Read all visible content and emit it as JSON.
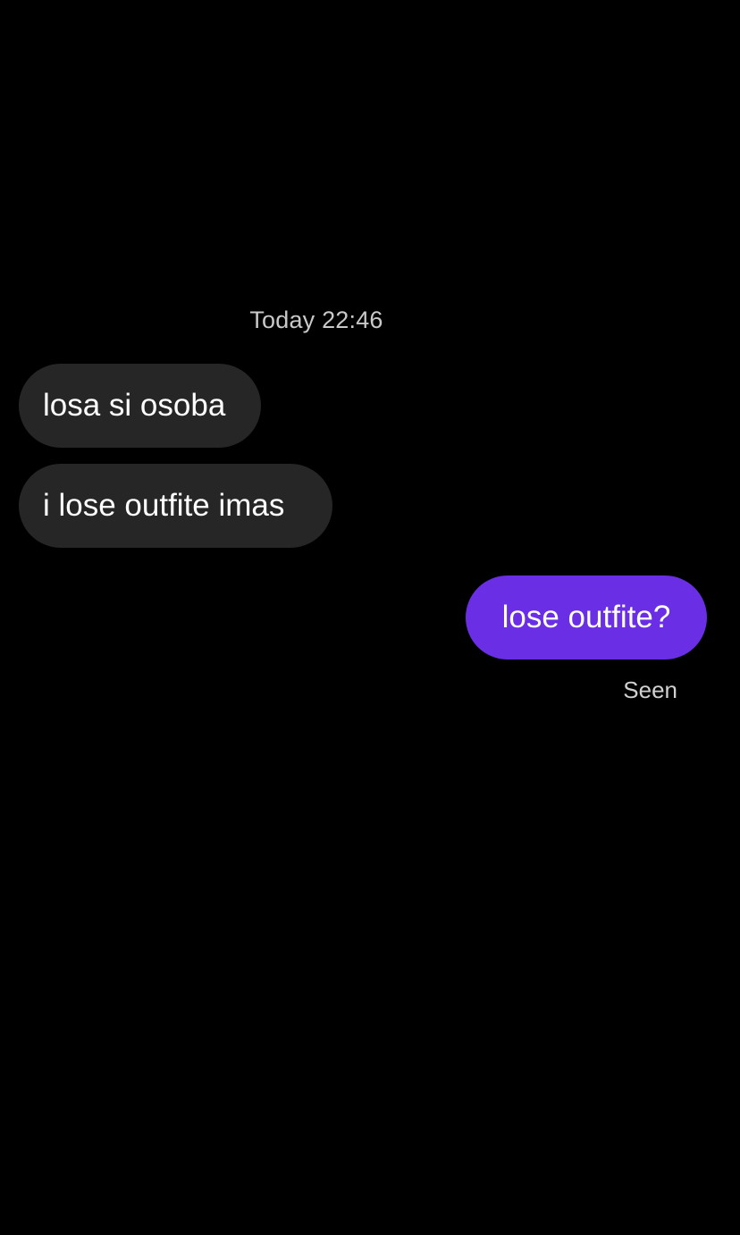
{
  "conversation": {
    "timestamp": "Today 22:46",
    "messages": [
      {
        "direction": "incoming",
        "text": "losa si osoba"
      },
      {
        "direction": "incoming",
        "text": "i lose outfite imas"
      },
      {
        "direction": "outgoing",
        "text": "lose outfite?"
      }
    ],
    "read_receipt": "Seen"
  },
  "colors": {
    "background": "#000000",
    "incoming_bubble": "#262626",
    "outgoing_bubble": "#6a2fe4",
    "meta_text": "#c9c9c9"
  }
}
